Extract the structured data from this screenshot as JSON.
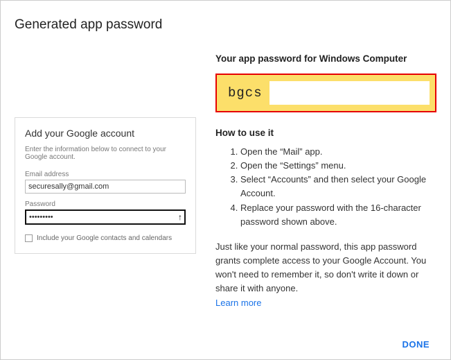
{
  "page_title": "Generated app password",
  "right": {
    "heading": "Your app password for Windows Computer",
    "password_visible": "bgcs",
    "howto_title": "How to use it",
    "steps": [
      "Open the “Mail” app.",
      "Open the “Settings” menu.",
      "Select “Accounts” and then select your Google Account.",
      "Replace your password with the 16-character password shown above."
    ],
    "disclaimer": "Just like your normal password, this app password grants complete access to your Google Account. You won't need to remember it, so don't write it down or share it with anyone.",
    "learn_more": "Learn more",
    "done": "DONE"
  },
  "left": {
    "panel_title": "Add your Google account",
    "intro": "Enter the information below to connect to your Google account.",
    "email_label": "Email address",
    "email_value": "securesally@gmail.com",
    "password_label": "Password",
    "password_value": "•••••••••",
    "checkbox_label": "Include your Google contacts and calendars"
  }
}
